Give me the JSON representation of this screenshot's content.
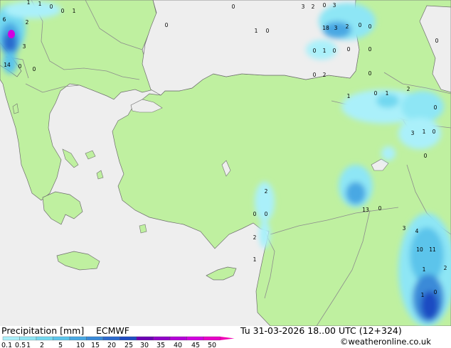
{
  "footer": {
    "title": "Precipitation [mm]",
    "model": "ECMWF",
    "datetime": "Tu 31-03-2026 18..00 UTC (12+324)",
    "credit": "©weatheronline.co.uk"
  },
  "legend": {
    "labels": [
      "0.1",
      "0.5",
      "1",
      "2",
      "5",
      "10",
      "15",
      "20",
      "25",
      "30",
      "35",
      "40",
      "45",
      "50"
    ],
    "colors": [
      "#aaf0fa",
      "#8ee6f5",
      "#72d8f0",
      "#5cc4eb",
      "#48a8e3",
      "#3a8ad8",
      "#2c6acd",
      "#1f4cc2",
      "#6c00b4",
      "#9000c8",
      "#b400d8",
      "#d200e0",
      "#e800c8"
    ]
  },
  "map_colors": {
    "sea": "#eeeeee",
    "land": "#bff0a0",
    "border": "#8c8c8c",
    "coast": "#6e6e6e"
  },
  "map_labels": [
    "1",
    "1",
    "0",
    "1",
    "6",
    "2",
    "3",
    "14",
    "0",
    "0",
    "0",
    "0",
    "3",
    "2",
    "0",
    "3",
    "18",
    "3",
    "2",
    "0",
    "0",
    "0",
    "1",
    "0",
    "0",
    "0",
    "0",
    "0",
    "1",
    "0",
    "0",
    "2",
    "2",
    "1",
    "0",
    "1",
    "0",
    "3",
    "1",
    "0",
    "0",
    "0",
    "2",
    "0",
    "0",
    "2",
    "1",
    "13",
    "0",
    "3",
    "4",
    "10",
    "11",
    "1",
    "2",
    "1",
    "0"
  ]
}
